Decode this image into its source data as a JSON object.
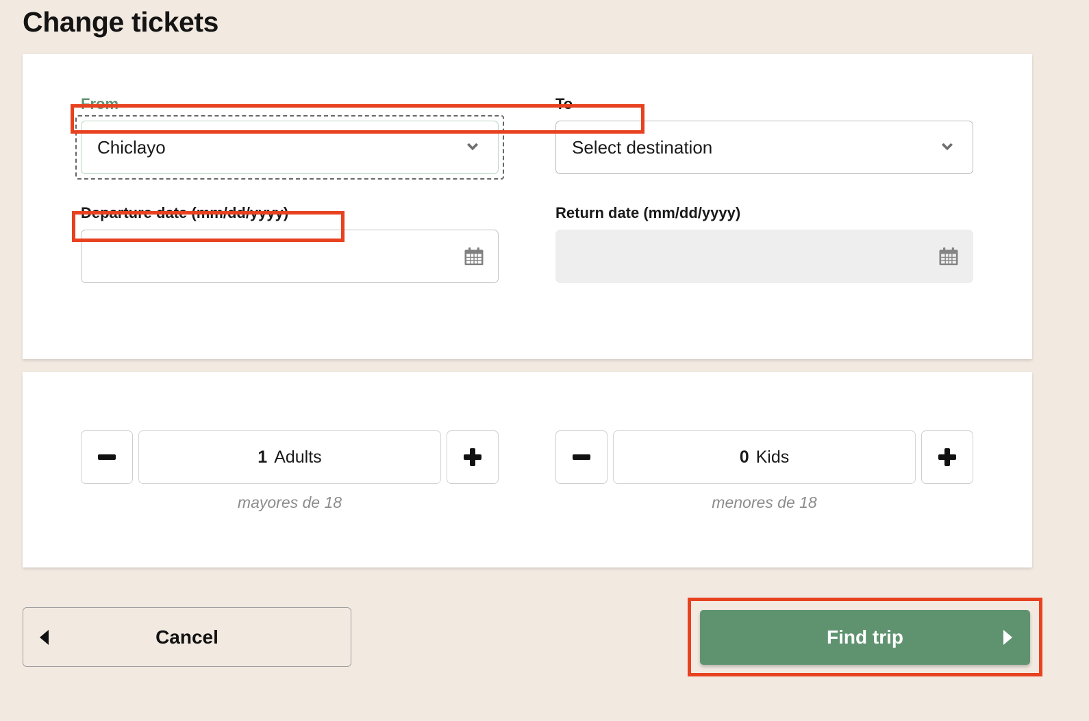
{
  "page": {
    "title": "Change tickets",
    "background_color": "#f2e9e1",
    "accent_green": "#5f9370",
    "annotation_color": "#e8411f"
  },
  "trip_form": {
    "from": {
      "label": "From",
      "label_color": "#5f9370",
      "selected_value": "Chiclayo",
      "icon": "chevron-down-icon",
      "focused": true
    },
    "to": {
      "label": "To",
      "selected_value": "Select destination",
      "icon": "chevron-down-icon",
      "focused": false
    },
    "departure_date": {
      "label": "Departure date (mm/dd/yyyy)",
      "value": "",
      "placeholder": "",
      "icon": "calendar-icon",
      "disabled": false
    },
    "return_date": {
      "label": "Return date (mm/dd/yyyy)",
      "value": "",
      "placeholder": "",
      "icon": "calendar-icon",
      "disabled": true
    }
  },
  "passengers": {
    "adults": {
      "decrement_icon": "minus-icon",
      "increment_icon": "plus-icon",
      "count": "1",
      "unit": "Adults",
      "hint": "mayores de 18"
    },
    "kids": {
      "decrement_icon": "minus-icon",
      "increment_icon": "plus-icon",
      "count": "0",
      "unit": "Kids",
      "hint": "menores de 18"
    }
  },
  "footer": {
    "cancel_label": "Cancel",
    "cancel_icon": "triangle-left-icon",
    "find_trip_label": "Find trip",
    "find_trip_icon": "triangle-right-icon"
  }
}
